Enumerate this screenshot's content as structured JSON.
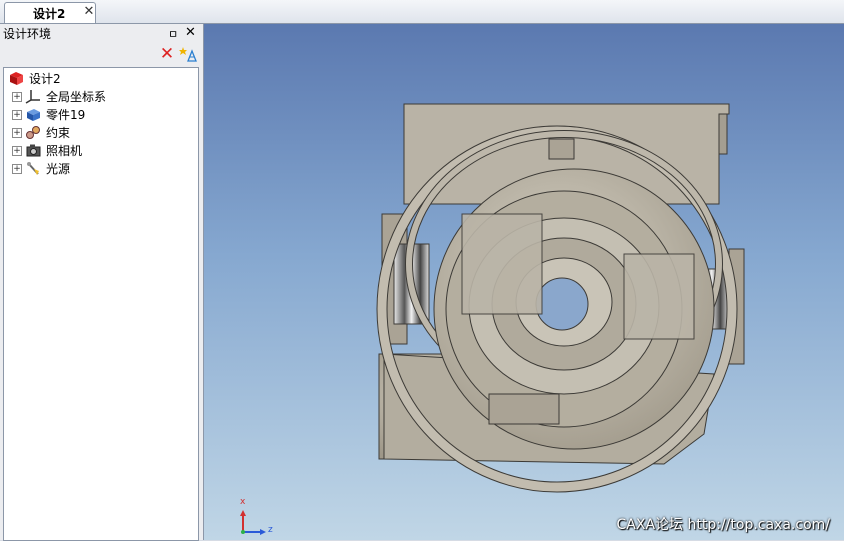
{
  "document": {
    "tab_label": "设计2",
    "close_icon": "close-icon"
  },
  "design_panel": {
    "title": "设计环境",
    "pin_glyph": "ㅁ",
    "tree": {
      "root": "设计2",
      "items": [
        {
          "label": "全局坐标系",
          "icon": "coordinate-system-icon"
        },
        {
          "label": "零件19",
          "icon": "part-icon"
        },
        {
          "label": "约束",
          "icon": "constraint-icon"
        },
        {
          "label": "照相机",
          "icon": "camera-icon"
        },
        {
          "label": "光源",
          "icon": "light-icon"
        }
      ]
    }
  },
  "viewport": {
    "axis_labels": {
      "x": "x",
      "z": "z"
    },
    "watermark": "CAXA论坛 http://top.caxa.com/"
  },
  "colors": {
    "viewport_top": "#5b79b0",
    "viewport_bottom": "#c0d6e6",
    "model": "#b8b2a4"
  }
}
